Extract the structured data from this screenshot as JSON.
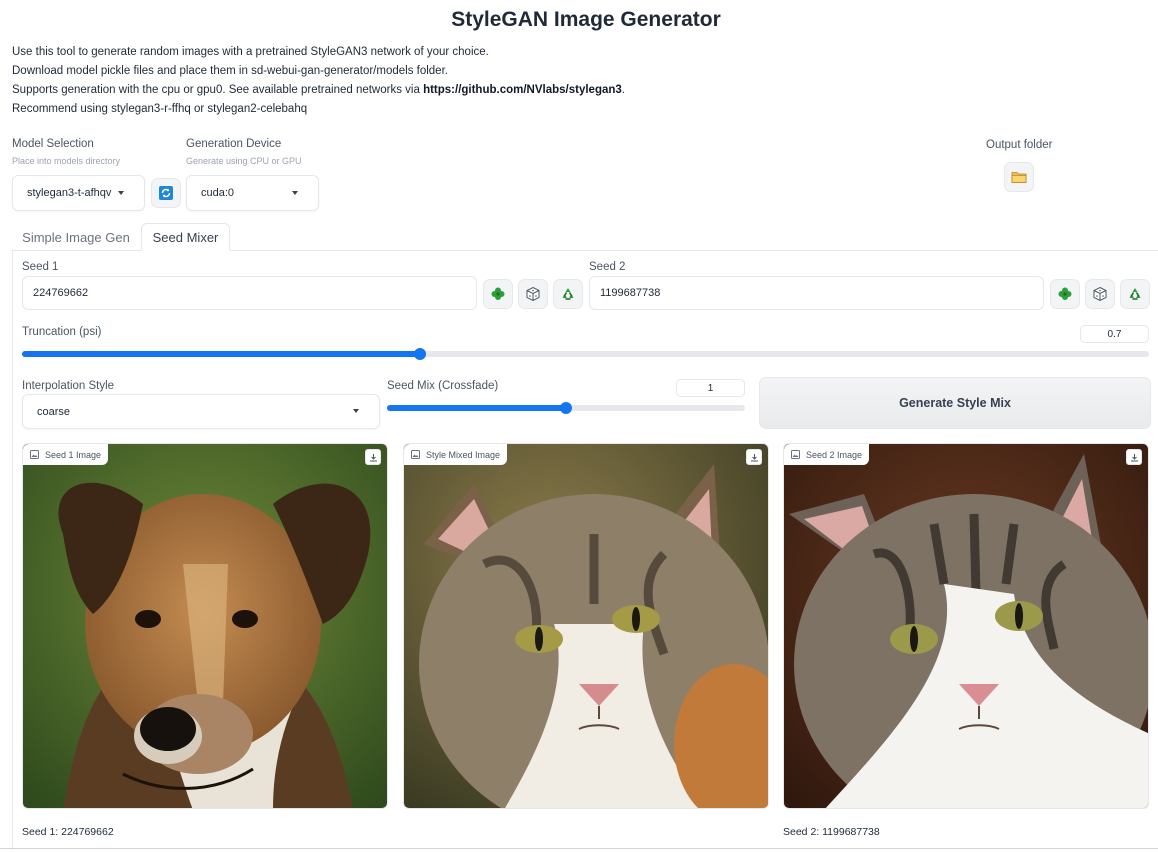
{
  "title": "StyleGAN Image Generator",
  "description": {
    "line1": "Use this tool to generate random images with a pretrained StyleGAN3 network of your choice.",
    "line2": "Download model pickle files and place them in sd-webui-gan-generator/models folder.",
    "line3_prefix": "Supports generation with the cpu or gpu0. See available pretrained networks via ",
    "line3_link": "https://github.com/NVlabs/stylegan3",
    "line3_suffix": ".",
    "line4": "Recommend using stylegan3-r-ffhq or stylegan2-celebahq"
  },
  "model": {
    "label": "Model Selection",
    "hint": "Place into models directory",
    "value": "stylegan3-t-afhqv"
  },
  "device": {
    "label": "Generation Device",
    "hint": "Generate using CPU or GPU",
    "value": "cuda:0"
  },
  "output": {
    "label": "Output folder"
  },
  "tabs": [
    {
      "label": "Simple Image Gen",
      "active": false
    },
    {
      "label": "Seed Mixer",
      "active": true
    }
  ],
  "seed1": {
    "label": "Seed 1",
    "value": "224769662"
  },
  "seed2": {
    "label": "Seed 2",
    "value": "1199687738"
  },
  "truncation": {
    "label": "Truncation (psi)",
    "value": "0.7",
    "fraction": 0.353
  },
  "interpolation": {
    "label": "Interpolation Style",
    "value": "coarse"
  },
  "seedmix": {
    "label": "Seed Mix (Crossfade)",
    "value": "1",
    "fraction": 0.5
  },
  "generate_button": "Generate Style Mix",
  "images": [
    {
      "tag": "Seed 1 Image",
      "caption": "Seed 1: 224769662"
    },
    {
      "tag": "Style Mixed Image",
      "caption": ""
    },
    {
      "tag": "Seed 2 Image",
      "caption": "Seed 2: 1199687738"
    }
  ],
  "colors": {
    "accent": "#1574f0",
    "border": "#e5e7eb"
  },
  "icons": [
    "refresh-icon",
    "folder-icon",
    "clover-icon",
    "dice-icon",
    "recycle-icon",
    "image-icon",
    "download-icon"
  ]
}
